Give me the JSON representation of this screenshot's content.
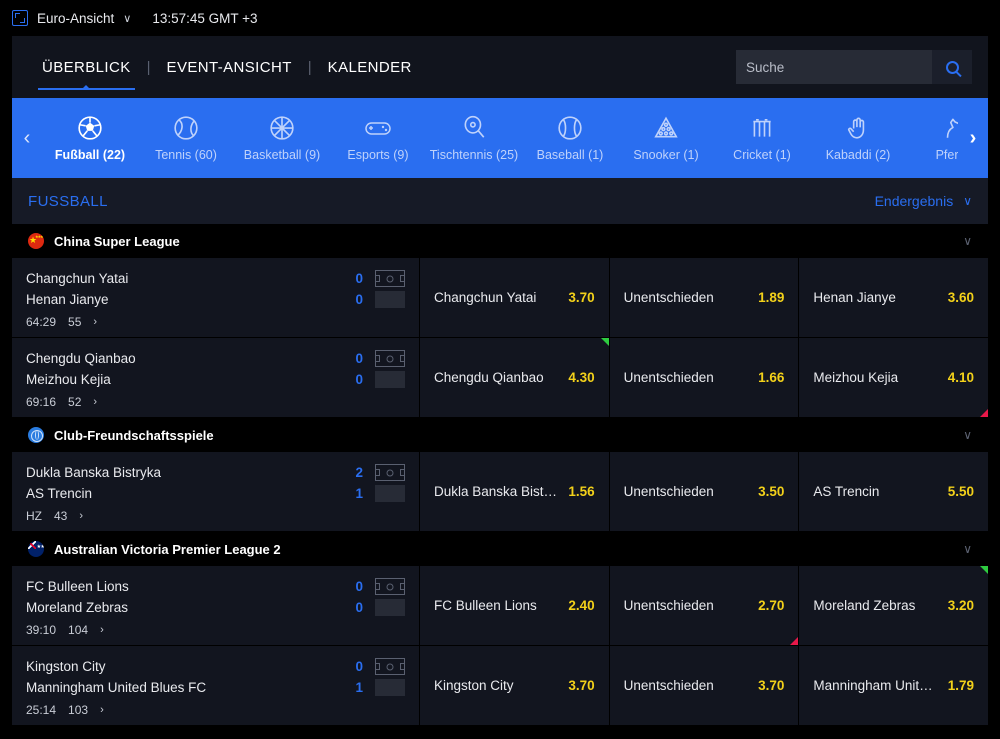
{
  "statusbar": {
    "icon": "euro-view-icon",
    "label": "Euro-Ansicht",
    "chevron": "∨",
    "time": "13:57:45 GMT +3"
  },
  "nav": {
    "tabs": [
      {
        "label": "ÜBERBLICK",
        "active": true
      },
      {
        "label": "EVENT-ANSICHT",
        "active": false
      },
      {
        "label": "KALENDER",
        "active": false
      }
    ],
    "separator": "|",
    "search": {
      "placeholder": "Suche",
      "value": "",
      "icon": "search-icon"
    }
  },
  "sports": {
    "prev_arrow": "‹",
    "next_arrow": "›",
    "items": [
      {
        "label": "Fußball (22)",
        "icon": "soccer-ball-icon",
        "active": true
      },
      {
        "label": "Tennis (60)",
        "icon": "tennis-ball-icon",
        "active": false
      },
      {
        "label": "Basketball (9)",
        "icon": "basketball-icon",
        "active": false
      },
      {
        "label": "Esports (9)",
        "icon": "gamepad-icon",
        "active": false
      },
      {
        "label": "Tischtennis (25)",
        "icon": "table-tennis-icon",
        "active": false
      },
      {
        "label": "Baseball (1)",
        "icon": "baseball-icon",
        "active": false
      },
      {
        "label": "Snooker (1)",
        "icon": "snooker-rack-icon",
        "active": false
      },
      {
        "label": "Cricket (1)",
        "icon": "cricket-wicket-icon",
        "active": false
      },
      {
        "label": "Kabaddi (2)",
        "icon": "hand-icon",
        "active": false
      },
      {
        "label": "Pferde",
        "icon": "horse-icon",
        "active": false
      }
    ]
  },
  "category": {
    "title": "FUSSBALL",
    "market_label": "Endergebnis",
    "market_chevron": "∨"
  },
  "colors": {
    "accent_blue": "#2a6ef0",
    "odds_yellow": "#f3d11a",
    "up_green": "#2ecc40",
    "down_red": "#e8184a",
    "row_bg": "#12151f",
    "page_bg": "#000000"
  },
  "leagues": [
    {
      "name": "China Super League",
      "flag": "cn",
      "chevron": "∨",
      "matches": [
        {
          "home": "Changchun Yatai",
          "away": "Henan Jianye",
          "home_score": "0",
          "away_score": "0",
          "time": "64:29",
          "minute": "55",
          "arrow": "›",
          "odds": [
            {
              "name": "Changchun Yatai",
              "value": "3.70",
              "trend": ""
            },
            {
              "name": "Unentschieden",
              "value": "1.89",
              "trend": ""
            },
            {
              "name": "Henan Jianye",
              "value": "3.60",
              "trend": ""
            }
          ]
        },
        {
          "home": "Chengdu Qianbao",
          "away": "Meizhou Kejia",
          "home_score": "0",
          "away_score": "0",
          "time": "69:16",
          "minute": "52",
          "arrow": "›",
          "odds": [
            {
              "name": "Chengdu Qianbao",
              "value": "4.30",
              "trend": "up"
            },
            {
              "name": "Unentschieden",
              "value": "1.66",
              "trend": ""
            },
            {
              "name": "Meizhou Kejia",
              "value": "4.10",
              "trend": "down"
            }
          ]
        }
      ]
    },
    {
      "name": "Club-Freundschaftsspiele",
      "flag": "globe",
      "chevron": "∨",
      "matches": [
        {
          "home": "Dukla Banska Bistryka",
          "away": "AS Trencin",
          "home_score": "2",
          "away_score": "1",
          "time": "HZ",
          "minute": "43",
          "arrow": "›",
          "odds": [
            {
              "name": "Dukla Banska Bist…",
              "value": "1.56",
              "trend": ""
            },
            {
              "name": "Unentschieden",
              "value": "3.50",
              "trend": ""
            },
            {
              "name": "AS Trencin",
              "value": "5.50",
              "trend": ""
            }
          ]
        }
      ]
    },
    {
      "name": "Australian Victoria Premier League 2",
      "flag": "au",
      "chevron": "∨",
      "matches": [
        {
          "home": "FC Bulleen Lions",
          "away": "Moreland Zebras",
          "home_score": "0",
          "away_score": "0",
          "time": "39:10",
          "minute": "104",
          "arrow": "›",
          "odds": [
            {
              "name": "FC Bulleen Lions",
              "value": "2.40",
              "trend": ""
            },
            {
              "name": "Unentschieden",
              "value": "2.70",
              "trend": "down"
            },
            {
              "name": "Moreland Zebras",
              "value": "3.20",
              "trend": "up"
            }
          ]
        },
        {
          "home": "Kingston City",
          "away": "Manningham United Blues FC",
          "home_score": "0",
          "away_score": "1",
          "time": "25:14",
          "minute": "103",
          "arrow": "›",
          "odds": [
            {
              "name": "Kingston City",
              "value": "3.70",
              "trend": ""
            },
            {
              "name": "Unentschieden",
              "value": "3.70",
              "trend": ""
            },
            {
              "name": "Manningham Unit…",
              "value": "1.79",
              "trend": ""
            }
          ]
        }
      ]
    }
  ]
}
